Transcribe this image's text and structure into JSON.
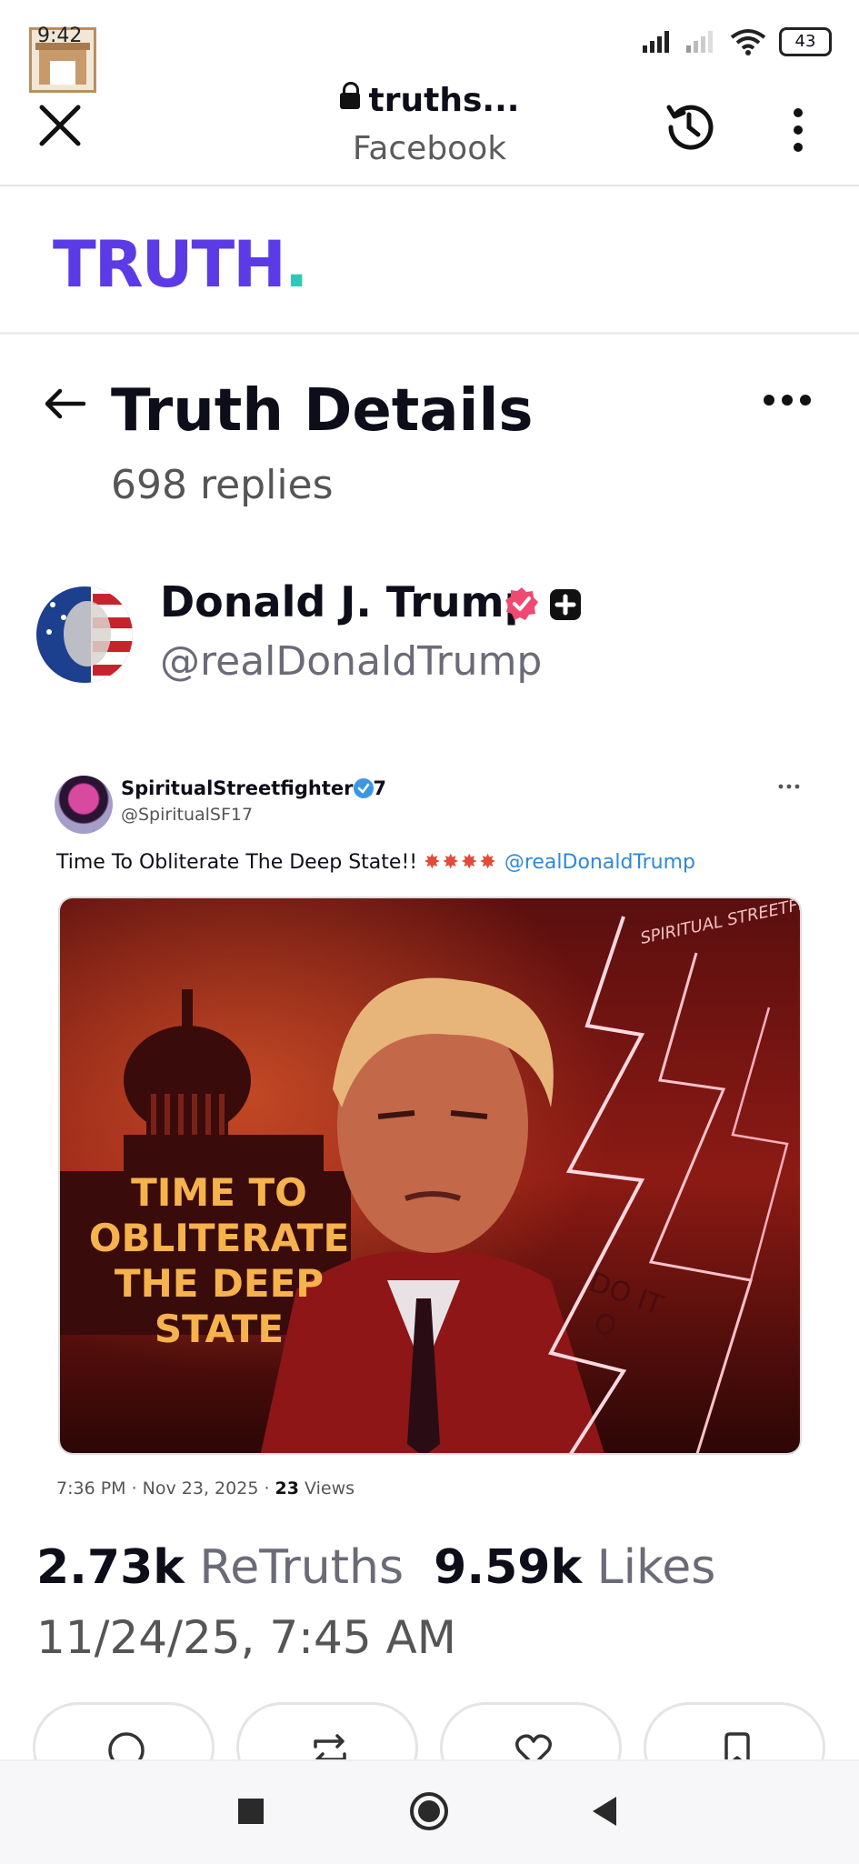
{
  "status_bar": {
    "time": "9:42",
    "battery": "43"
  },
  "browser": {
    "url": "truths...",
    "source": "Facebook"
  },
  "logo": {
    "text": "TRUTH",
    "dot": ".",
    "brand_color": "#5a3be6",
    "dot_color": "#2ec9b6"
  },
  "page": {
    "title": "Truth Details",
    "reply_count": "698 replies"
  },
  "author": {
    "name": "Donald J. Trump",
    "handle": "@realDonaldTrump"
  },
  "embedded_post": {
    "name": "SpiritualStreetfighter 17",
    "handle": "@SpiritualSF17",
    "text": "Time To Obliterate The Deep State!!",
    "emoji_bursts": "✸✸✸✸",
    "mention": "@realDonaldTrump",
    "image": {
      "caption_lines": [
        "TIME TO",
        "OBLITERATE",
        "THE DEEP",
        "STATE"
      ],
      "watermark": "SPIRITUAL STREETFIGHTER",
      "lapel_text": [
        "DO IT",
        "Q"
      ]
    },
    "time": "7:36 PM · Nov 23, 2025 · ",
    "views_count": "23",
    "views_label": " Views"
  },
  "stats": {
    "retruths_count": "2.73k",
    "retruths_label": "ReTruths",
    "likes_count": "9.59k",
    "likes_label": "Likes",
    "posted_at": "11/24/25, 7:45 AM"
  },
  "actions": [
    "reply-icon",
    "retruth-icon",
    "like-icon",
    "bookmark-icon"
  ]
}
